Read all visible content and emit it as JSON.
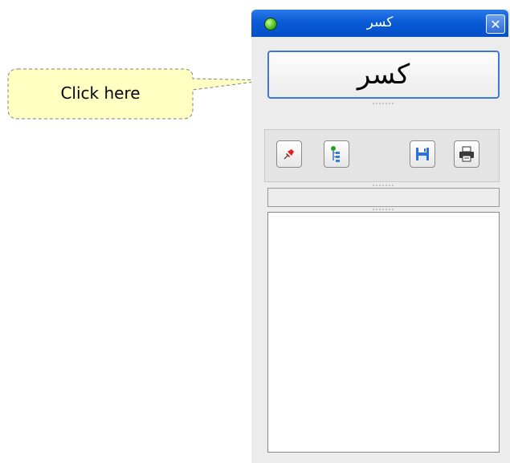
{
  "callout": {
    "text": "Click here"
  },
  "window": {
    "title": "کسر",
    "close_label": "✕",
    "main_button_label": "کسر",
    "toolbar": {
      "pin": "pin-icon",
      "tree": "tree-icon",
      "save": "save-icon",
      "print": "print-icon"
    }
  },
  "colors": {
    "titlebar": "#0a5ad6",
    "callout_fill": "#ffffc2",
    "button_border": "#3b79d4"
  }
}
